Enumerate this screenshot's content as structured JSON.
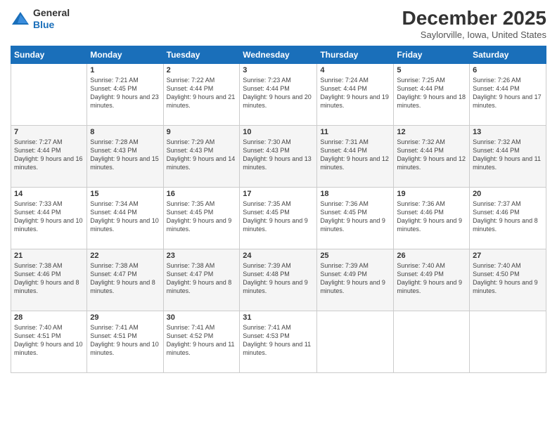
{
  "logo": {
    "general": "General",
    "blue": "Blue"
  },
  "header": {
    "month": "December 2025",
    "location": "Saylorville, Iowa, United States"
  },
  "weekdays": [
    "Sunday",
    "Monday",
    "Tuesday",
    "Wednesday",
    "Thursday",
    "Friday",
    "Saturday"
  ],
  "weeks": [
    [
      {
        "day": "",
        "sunrise": "",
        "sunset": "",
        "daylight": ""
      },
      {
        "day": "1",
        "sunrise": "Sunrise: 7:21 AM",
        "sunset": "Sunset: 4:45 PM",
        "daylight": "Daylight: 9 hours and 23 minutes."
      },
      {
        "day": "2",
        "sunrise": "Sunrise: 7:22 AM",
        "sunset": "Sunset: 4:44 PM",
        "daylight": "Daylight: 9 hours and 21 minutes."
      },
      {
        "day": "3",
        "sunrise": "Sunrise: 7:23 AM",
        "sunset": "Sunset: 4:44 PM",
        "daylight": "Daylight: 9 hours and 20 minutes."
      },
      {
        "day": "4",
        "sunrise": "Sunrise: 7:24 AM",
        "sunset": "Sunset: 4:44 PM",
        "daylight": "Daylight: 9 hours and 19 minutes."
      },
      {
        "day": "5",
        "sunrise": "Sunrise: 7:25 AM",
        "sunset": "Sunset: 4:44 PM",
        "daylight": "Daylight: 9 hours and 18 minutes."
      },
      {
        "day": "6",
        "sunrise": "Sunrise: 7:26 AM",
        "sunset": "Sunset: 4:44 PM",
        "daylight": "Daylight: 9 hours and 17 minutes."
      }
    ],
    [
      {
        "day": "7",
        "sunrise": "Sunrise: 7:27 AM",
        "sunset": "Sunset: 4:44 PM",
        "daylight": "Daylight: 9 hours and 16 minutes."
      },
      {
        "day": "8",
        "sunrise": "Sunrise: 7:28 AM",
        "sunset": "Sunset: 4:43 PM",
        "daylight": "Daylight: 9 hours and 15 minutes."
      },
      {
        "day": "9",
        "sunrise": "Sunrise: 7:29 AM",
        "sunset": "Sunset: 4:43 PM",
        "daylight": "Daylight: 9 hours and 14 minutes."
      },
      {
        "day": "10",
        "sunrise": "Sunrise: 7:30 AM",
        "sunset": "Sunset: 4:43 PM",
        "daylight": "Daylight: 9 hours and 13 minutes."
      },
      {
        "day": "11",
        "sunrise": "Sunrise: 7:31 AM",
        "sunset": "Sunset: 4:44 PM",
        "daylight": "Daylight: 9 hours and 12 minutes."
      },
      {
        "day": "12",
        "sunrise": "Sunrise: 7:32 AM",
        "sunset": "Sunset: 4:44 PM",
        "daylight": "Daylight: 9 hours and 12 minutes."
      },
      {
        "day": "13",
        "sunrise": "Sunrise: 7:32 AM",
        "sunset": "Sunset: 4:44 PM",
        "daylight": "Daylight: 9 hours and 11 minutes."
      }
    ],
    [
      {
        "day": "14",
        "sunrise": "Sunrise: 7:33 AM",
        "sunset": "Sunset: 4:44 PM",
        "daylight": "Daylight: 9 hours and 10 minutes."
      },
      {
        "day": "15",
        "sunrise": "Sunrise: 7:34 AM",
        "sunset": "Sunset: 4:44 PM",
        "daylight": "Daylight: 9 hours and 10 minutes."
      },
      {
        "day": "16",
        "sunrise": "Sunrise: 7:35 AM",
        "sunset": "Sunset: 4:45 PM",
        "daylight": "Daylight: 9 hours and 9 minutes."
      },
      {
        "day": "17",
        "sunrise": "Sunrise: 7:35 AM",
        "sunset": "Sunset: 4:45 PM",
        "daylight": "Daylight: 9 hours and 9 minutes."
      },
      {
        "day": "18",
        "sunrise": "Sunrise: 7:36 AM",
        "sunset": "Sunset: 4:45 PM",
        "daylight": "Daylight: 9 hours and 9 minutes."
      },
      {
        "day": "19",
        "sunrise": "Sunrise: 7:36 AM",
        "sunset": "Sunset: 4:46 PM",
        "daylight": "Daylight: 9 hours and 9 minutes."
      },
      {
        "day": "20",
        "sunrise": "Sunrise: 7:37 AM",
        "sunset": "Sunset: 4:46 PM",
        "daylight": "Daylight: 9 hours and 8 minutes."
      }
    ],
    [
      {
        "day": "21",
        "sunrise": "Sunrise: 7:38 AM",
        "sunset": "Sunset: 4:46 PM",
        "daylight": "Daylight: 9 hours and 8 minutes."
      },
      {
        "day": "22",
        "sunrise": "Sunrise: 7:38 AM",
        "sunset": "Sunset: 4:47 PM",
        "daylight": "Daylight: 9 hours and 8 minutes."
      },
      {
        "day": "23",
        "sunrise": "Sunrise: 7:38 AM",
        "sunset": "Sunset: 4:47 PM",
        "daylight": "Daylight: 9 hours and 8 minutes."
      },
      {
        "day": "24",
        "sunrise": "Sunrise: 7:39 AM",
        "sunset": "Sunset: 4:48 PM",
        "daylight": "Daylight: 9 hours and 9 minutes."
      },
      {
        "day": "25",
        "sunrise": "Sunrise: 7:39 AM",
        "sunset": "Sunset: 4:49 PM",
        "daylight": "Daylight: 9 hours and 9 minutes."
      },
      {
        "day": "26",
        "sunrise": "Sunrise: 7:40 AM",
        "sunset": "Sunset: 4:49 PM",
        "daylight": "Daylight: 9 hours and 9 minutes."
      },
      {
        "day": "27",
        "sunrise": "Sunrise: 7:40 AM",
        "sunset": "Sunset: 4:50 PM",
        "daylight": "Daylight: 9 hours and 9 minutes."
      }
    ],
    [
      {
        "day": "28",
        "sunrise": "Sunrise: 7:40 AM",
        "sunset": "Sunset: 4:51 PM",
        "daylight": "Daylight: 9 hours and 10 minutes."
      },
      {
        "day": "29",
        "sunrise": "Sunrise: 7:41 AM",
        "sunset": "Sunset: 4:51 PM",
        "daylight": "Daylight: 9 hours and 10 minutes."
      },
      {
        "day": "30",
        "sunrise": "Sunrise: 7:41 AM",
        "sunset": "Sunset: 4:52 PM",
        "daylight": "Daylight: 9 hours and 11 minutes."
      },
      {
        "day": "31",
        "sunrise": "Sunrise: 7:41 AM",
        "sunset": "Sunset: 4:53 PM",
        "daylight": "Daylight: 9 hours and 11 minutes."
      },
      {
        "day": "",
        "sunrise": "",
        "sunset": "",
        "daylight": ""
      },
      {
        "day": "",
        "sunrise": "",
        "sunset": "",
        "daylight": ""
      },
      {
        "day": "",
        "sunrise": "",
        "sunset": "",
        "daylight": ""
      }
    ]
  ]
}
